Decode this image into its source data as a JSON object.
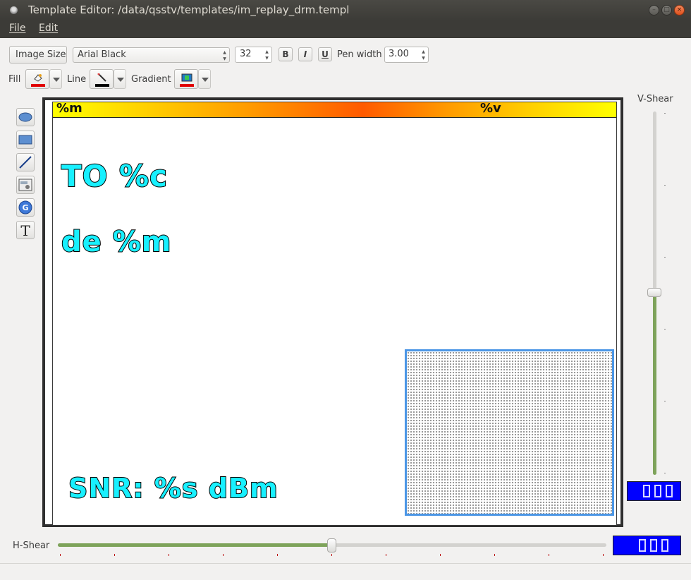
{
  "window": {
    "title": "Template Editor: /data/qsstv/templates/im_replay_drm.templ"
  },
  "menu": {
    "file": "File",
    "edit": "Edit"
  },
  "toolbar": {
    "image_size_label": "Image Size",
    "font_name": "Arial Black",
    "font_size": "32",
    "bold_label": "B",
    "italic_label": "I",
    "underline_label": "U",
    "pen_width_label": "Pen width",
    "pen_width_value": "3.00",
    "fill_label": "Fill",
    "line_label": "Line",
    "gradient_label": "Gradient"
  },
  "tools": [
    "ellipse-tool",
    "rectangle-tool",
    "line-tool",
    "image-tool",
    "replay-tool",
    "text-tool"
  ],
  "canvas": {
    "top_bar_left": "%m",
    "top_bar_right": "%v",
    "text_to": "TO %c",
    "text_de": "de %m",
    "text_snr": "SNR: %s dBm"
  },
  "vshear": {
    "label": "V-Shear",
    "level": 0.5
  },
  "hshear": {
    "label": "H-Shear",
    "level": 0.5
  },
  "colors": {
    "text_fill": "#18f0ff",
    "text_outline": "#000000",
    "image_frame": "#4b96e6",
    "slider_fill": "#7ea35a",
    "lcd_background": "#0000ff"
  }
}
